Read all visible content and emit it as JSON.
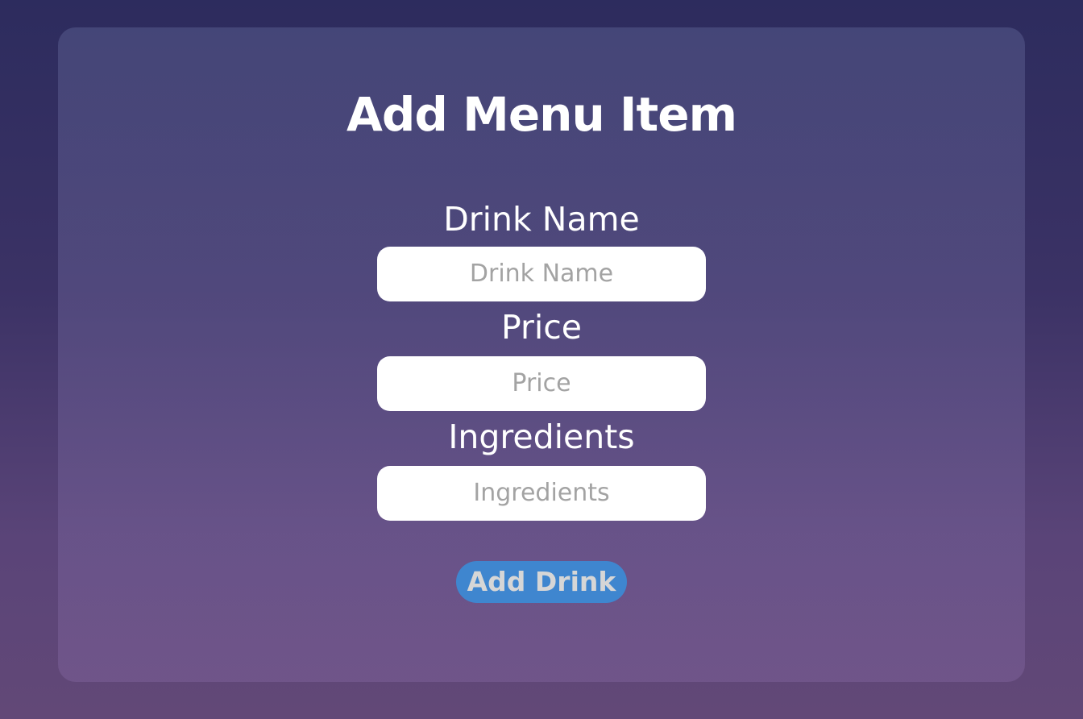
{
  "form": {
    "title": "Add Menu Item",
    "fields": [
      {
        "label": "Drink Name",
        "placeholder": "Drink Name",
        "value": ""
      },
      {
        "label": "Price",
        "placeholder": "Price",
        "value": ""
      },
      {
        "label": "Ingredients",
        "placeholder": "Ingredients",
        "value": ""
      }
    ],
    "submit_label": "Add Drink"
  },
  "colors": {
    "background_top": "#2d2c5e",
    "background_bottom": "#624877",
    "button": "#3f86cf",
    "input_background": "#ffffff",
    "placeholder": "#a3a3a3"
  }
}
